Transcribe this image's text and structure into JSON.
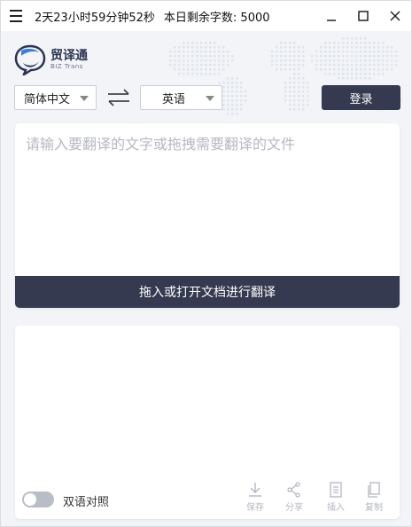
{
  "titlebar": {
    "timer": "2天23小时59分钟52秒",
    "quota": "本日剩余字数: 5000"
  },
  "logo": {
    "name": "贸译通",
    "sub": "BIZ Trans"
  },
  "languages": {
    "source": "简体中文",
    "target": "英语"
  },
  "login_label": "登录",
  "input": {
    "placeholder": "请输入要翻译的文字或拖拽需要翻译的文件",
    "value": ""
  },
  "drop_bar_label": "拖入或打开文档进行翻译",
  "output": {
    "bilingual_label": "双语对照",
    "bilingual_on": false,
    "tools": [
      {
        "label": "保存",
        "icon": "download-icon"
      },
      {
        "label": "分享",
        "icon": "share-icon"
      },
      {
        "label": "插入",
        "icon": "insert-icon"
      },
      {
        "label": "复制",
        "icon": "copy-icon"
      }
    ]
  },
  "colors": {
    "accent": "#353a50",
    "background": "#f2f4f8"
  }
}
